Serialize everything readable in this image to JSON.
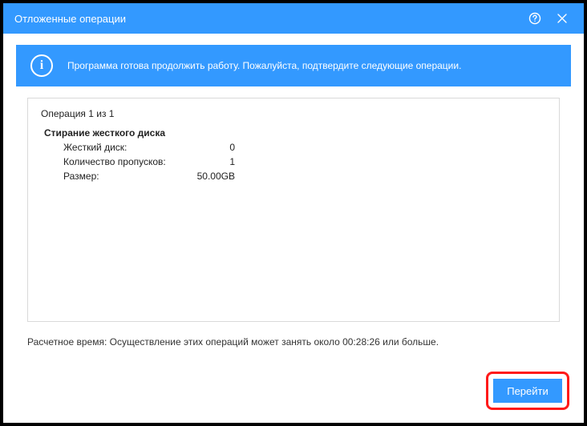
{
  "titlebar": {
    "title": "Отложенные операции"
  },
  "banner": {
    "message": "Программа готова продолжить работу. Пожалуйста, подтвердите следующие операции."
  },
  "operations": {
    "count_label": "Операция 1 из 1",
    "op_title": "Стирание жесткого диска",
    "rows": [
      {
        "label": "Жесткий диск:",
        "value": "0"
      },
      {
        "label": "Количество пропусков:",
        "value": "1"
      },
      {
        "label": "Размер:",
        "value": "50.00GB"
      }
    ]
  },
  "estimate": {
    "text": "Расчетное время: Осуществление этих операций может занять около 00:28:26 или больше."
  },
  "buttons": {
    "go": "Перейти"
  }
}
